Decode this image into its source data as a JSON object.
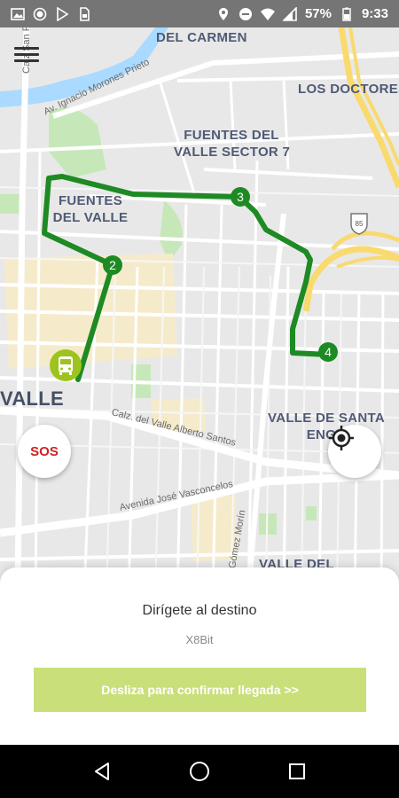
{
  "status_bar": {
    "left_icons": [
      "image-icon",
      "record-icon",
      "play-store-icon",
      "sim-icon"
    ],
    "right_icons": [
      "location-icon",
      "do-not-disturb-icon",
      "wifi-icon",
      "cellular-icon",
      "battery-icon"
    ],
    "battery": "57%",
    "time": "9:33"
  },
  "map": {
    "labels": {
      "del_carmen": "DEL CARMEN",
      "los_doctores": "LOS DOCTORES",
      "fuentes_sector7_line1": "FUENTES DEL",
      "fuentes_sector7_line2": "VALLE SECTOR 7",
      "fuentes_valle_line1": "FUENTES",
      "fuentes_valle_line2": "DEL VALLE",
      "valle": "VALLE",
      "valle_santa_line1": "VALLE DE SANTA",
      "valle_santa_line2": "ENGR",
      "valle_del": "VALLE DEL"
    },
    "streets": {
      "calz_top": "Calz San Pedro",
      "morones": "Av. Ignacio Morones Prieto",
      "alberto_santos": "Calz. del Valle Alberto Santos",
      "vasconcelos": "Avenida José Vasconcelos",
      "gomez_morin": "Gómez Morín"
    },
    "highway_shield": "85",
    "route_waypoints": [
      "2",
      "3",
      "4"
    ]
  },
  "buttons": {
    "sos": "SOS"
  },
  "sheet": {
    "instruction": "Dirígete al destino",
    "code": "X8Bit",
    "confirm": "Desliza para confirmar llegada >>"
  },
  "colors": {
    "route": "#1e8a23",
    "bus_marker": "#9dc31f",
    "confirm_button": "#c9df7a",
    "sos_text": "#d32020"
  }
}
